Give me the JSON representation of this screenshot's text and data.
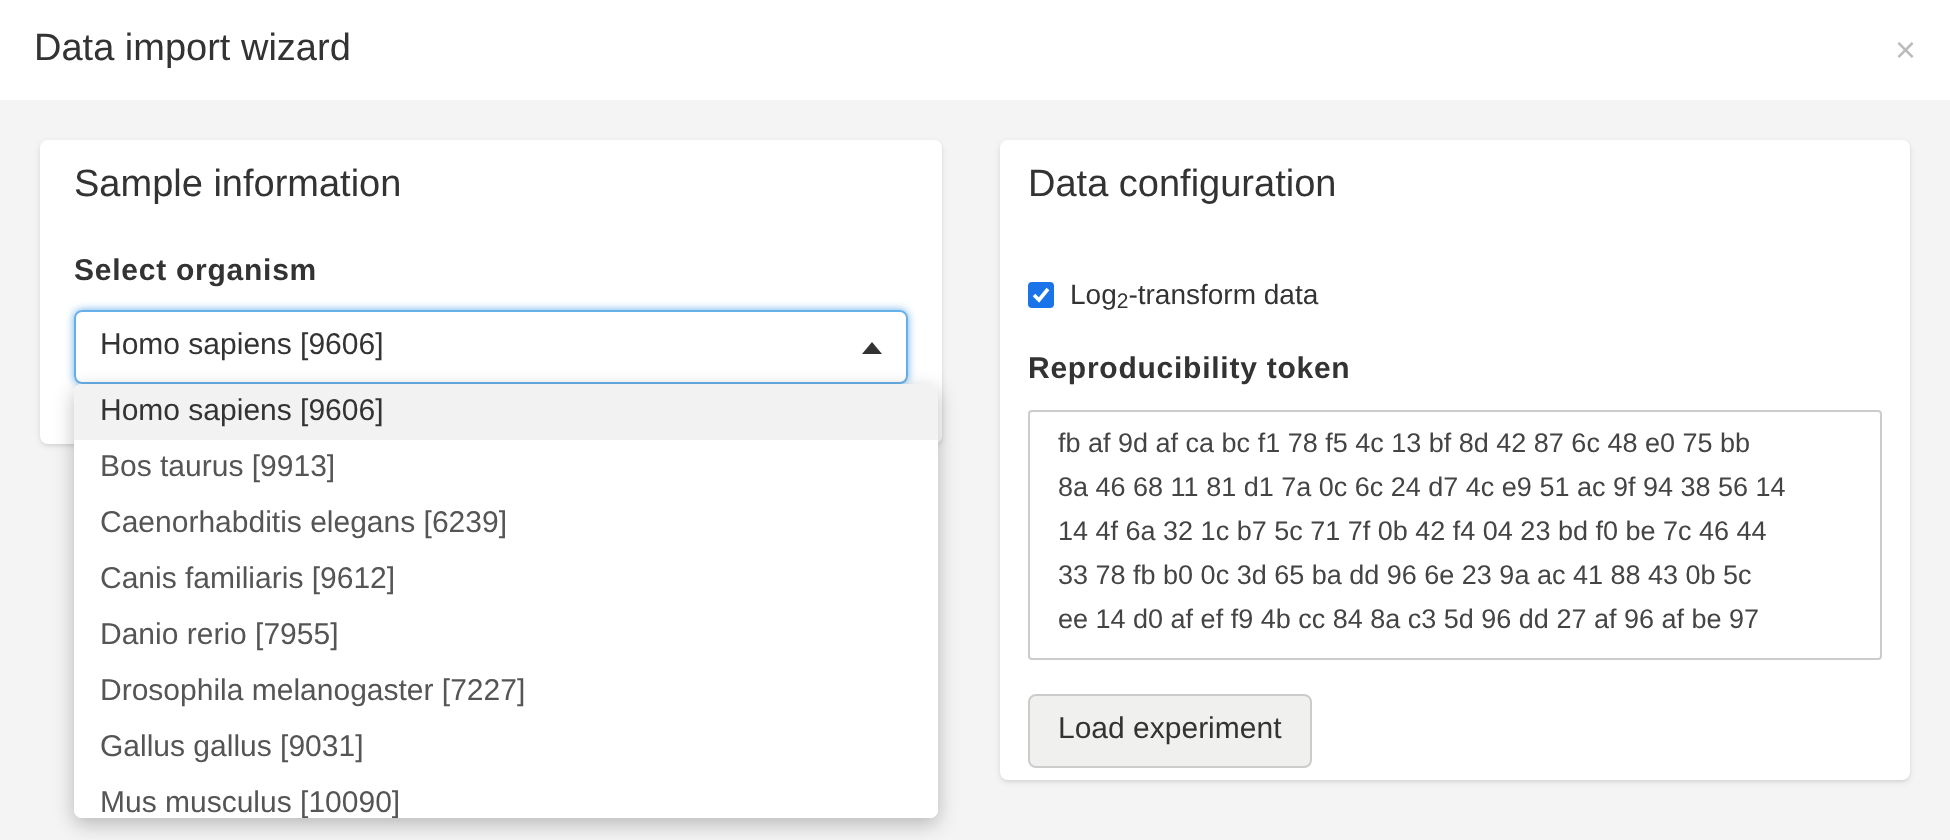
{
  "dialog": {
    "title": "Data import wizard",
    "close": "×"
  },
  "sample_information": {
    "title": "Sample information",
    "organism_label": "Select organism",
    "organism_value": "Homo sapiens [9606]",
    "dropdown_expanded": true,
    "options": [
      {
        "label": "Homo sapiens [9606]",
        "selected": true
      },
      {
        "label": "Bos taurus [9913]",
        "selected": false
      },
      {
        "label": "Caenorhabditis elegans [6239]",
        "selected": false
      },
      {
        "label": "Canis familiaris [9612]",
        "selected": false
      },
      {
        "label": "Danio rerio [7955]",
        "selected": false
      },
      {
        "label": "Drosophila melanogaster [7227]",
        "selected": false
      },
      {
        "label": "Gallus gallus [9031]",
        "selected": false
      },
      {
        "label": "Mus musculus [10090]",
        "selected": false
      }
    ]
  },
  "data_configuration": {
    "title": "Data configuration",
    "log_transform": {
      "label": "Log$_{2}$-transform data",
      "checked": true
    },
    "token_label": "Reproducibility token",
    "token_lines": [
      "fb af 9d af ca bc f1 78 f5 4c 13 bf 8d 42 87 6c 48 e0 75 bb",
      "8a 46 68 11 81 d1 7a 0c 6c 24 d7 4c e9 51 ac 9f 94 38 56 14",
      "14 4f 6a 32 1c b7 5c 71 7f 0b 42 f4 04 23 bd f0 be 7c 46 44",
      "33 78 fb b0 0c 3d 65 ba dd 96 6e 23 9a ac 41 88 43 0b 5c",
      "ee 14 d0 af ef f9 4b cc 84 8a c3 5d 96 dd 27 af 96 af be 97"
    ],
    "load_button": "Load experiment"
  }
}
